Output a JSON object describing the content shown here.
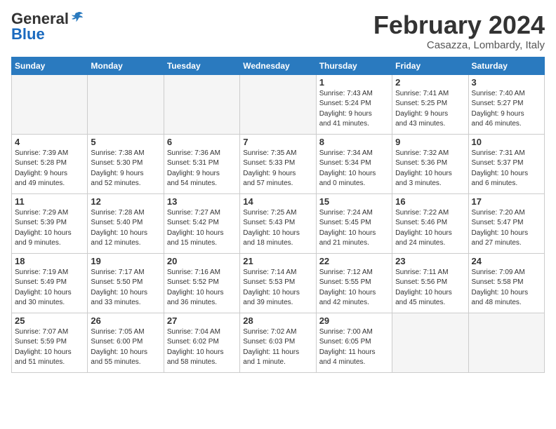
{
  "logo": {
    "general": "General",
    "blue": "Blue"
  },
  "title": {
    "month_year": "February 2024",
    "location": "Casazza, Lombardy, Italy"
  },
  "days_of_week": [
    "Sunday",
    "Monday",
    "Tuesday",
    "Wednesday",
    "Thursday",
    "Friday",
    "Saturday"
  ],
  "weeks": [
    {
      "days": [
        {
          "num": "",
          "info": "",
          "empty": true
        },
        {
          "num": "",
          "info": "",
          "empty": true
        },
        {
          "num": "",
          "info": "",
          "empty": true
        },
        {
          "num": "",
          "info": "",
          "empty": true
        },
        {
          "num": "1",
          "info": "Sunrise: 7:43 AM\nSunset: 5:24 PM\nDaylight: 9 hours\nand 41 minutes."
        },
        {
          "num": "2",
          "info": "Sunrise: 7:41 AM\nSunset: 5:25 PM\nDaylight: 9 hours\nand 43 minutes."
        },
        {
          "num": "3",
          "info": "Sunrise: 7:40 AM\nSunset: 5:27 PM\nDaylight: 9 hours\nand 46 minutes."
        }
      ]
    },
    {
      "days": [
        {
          "num": "4",
          "info": "Sunrise: 7:39 AM\nSunset: 5:28 PM\nDaylight: 9 hours\nand 49 minutes."
        },
        {
          "num": "5",
          "info": "Sunrise: 7:38 AM\nSunset: 5:30 PM\nDaylight: 9 hours\nand 52 minutes."
        },
        {
          "num": "6",
          "info": "Sunrise: 7:36 AM\nSunset: 5:31 PM\nDaylight: 9 hours\nand 54 minutes."
        },
        {
          "num": "7",
          "info": "Sunrise: 7:35 AM\nSunset: 5:33 PM\nDaylight: 9 hours\nand 57 minutes."
        },
        {
          "num": "8",
          "info": "Sunrise: 7:34 AM\nSunset: 5:34 PM\nDaylight: 10 hours\nand 0 minutes."
        },
        {
          "num": "9",
          "info": "Sunrise: 7:32 AM\nSunset: 5:36 PM\nDaylight: 10 hours\nand 3 minutes."
        },
        {
          "num": "10",
          "info": "Sunrise: 7:31 AM\nSunset: 5:37 PM\nDaylight: 10 hours\nand 6 minutes."
        }
      ]
    },
    {
      "days": [
        {
          "num": "11",
          "info": "Sunrise: 7:29 AM\nSunset: 5:39 PM\nDaylight: 10 hours\nand 9 minutes."
        },
        {
          "num": "12",
          "info": "Sunrise: 7:28 AM\nSunset: 5:40 PM\nDaylight: 10 hours\nand 12 minutes."
        },
        {
          "num": "13",
          "info": "Sunrise: 7:27 AM\nSunset: 5:42 PM\nDaylight: 10 hours\nand 15 minutes."
        },
        {
          "num": "14",
          "info": "Sunrise: 7:25 AM\nSunset: 5:43 PM\nDaylight: 10 hours\nand 18 minutes."
        },
        {
          "num": "15",
          "info": "Sunrise: 7:24 AM\nSunset: 5:45 PM\nDaylight: 10 hours\nand 21 minutes."
        },
        {
          "num": "16",
          "info": "Sunrise: 7:22 AM\nSunset: 5:46 PM\nDaylight: 10 hours\nand 24 minutes."
        },
        {
          "num": "17",
          "info": "Sunrise: 7:20 AM\nSunset: 5:47 PM\nDaylight: 10 hours\nand 27 minutes."
        }
      ]
    },
    {
      "days": [
        {
          "num": "18",
          "info": "Sunrise: 7:19 AM\nSunset: 5:49 PM\nDaylight: 10 hours\nand 30 minutes."
        },
        {
          "num": "19",
          "info": "Sunrise: 7:17 AM\nSunset: 5:50 PM\nDaylight: 10 hours\nand 33 minutes."
        },
        {
          "num": "20",
          "info": "Sunrise: 7:16 AM\nSunset: 5:52 PM\nDaylight: 10 hours\nand 36 minutes."
        },
        {
          "num": "21",
          "info": "Sunrise: 7:14 AM\nSunset: 5:53 PM\nDaylight: 10 hours\nand 39 minutes."
        },
        {
          "num": "22",
          "info": "Sunrise: 7:12 AM\nSunset: 5:55 PM\nDaylight: 10 hours\nand 42 minutes."
        },
        {
          "num": "23",
          "info": "Sunrise: 7:11 AM\nSunset: 5:56 PM\nDaylight: 10 hours\nand 45 minutes."
        },
        {
          "num": "24",
          "info": "Sunrise: 7:09 AM\nSunset: 5:58 PM\nDaylight: 10 hours\nand 48 minutes."
        }
      ]
    },
    {
      "days": [
        {
          "num": "25",
          "info": "Sunrise: 7:07 AM\nSunset: 5:59 PM\nDaylight: 10 hours\nand 51 minutes."
        },
        {
          "num": "26",
          "info": "Sunrise: 7:05 AM\nSunset: 6:00 PM\nDaylight: 10 hours\nand 55 minutes."
        },
        {
          "num": "27",
          "info": "Sunrise: 7:04 AM\nSunset: 6:02 PM\nDaylight: 10 hours\nand 58 minutes."
        },
        {
          "num": "28",
          "info": "Sunrise: 7:02 AM\nSunset: 6:03 PM\nDaylight: 11 hours\nand 1 minute."
        },
        {
          "num": "29",
          "info": "Sunrise: 7:00 AM\nSunset: 6:05 PM\nDaylight: 11 hours\nand 4 minutes."
        },
        {
          "num": "",
          "info": "",
          "empty": true
        },
        {
          "num": "",
          "info": "",
          "empty": true
        }
      ]
    }
  ]
}
